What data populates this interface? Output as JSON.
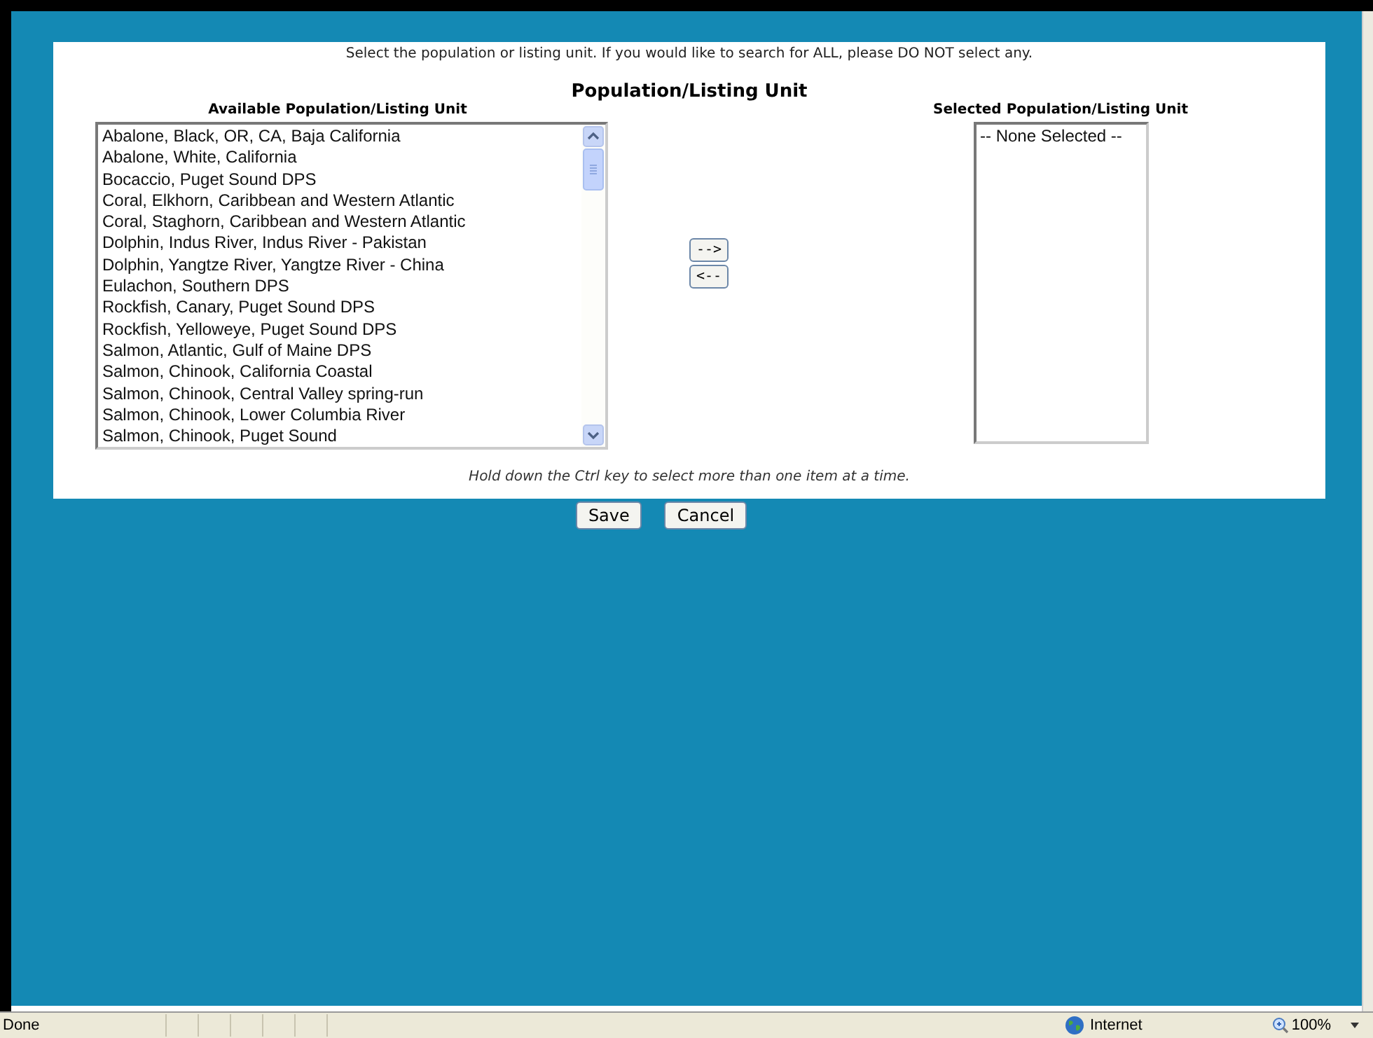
{
  "instruction": "Select the population or listing unit. If you would like to search for ALL, please DO NOT select any.",
  "title": "Population/Listing Unit",
  "available": {
    "heading": "Available Population/Listing Unit",
    "items": [
      {
        "label": "Abalone, Black, OR, CA, Baja California"
      },
      {
        "label": "Abalone, White, California"
      },
      {
        "label": "Bocaccio, Puget Sound DPS"
      },
      {
        "label": "Coral, Elkhorn, Caribbean and Western Atlantic"
      },
      {
        "label": "Coral, Staghorn, Caribbean and Western Atlantic"
      },
      {
        "label": "Dolphin, Indus River, Indus River - Pakistan"
      },
      {
        "label": "Dolphin, Yangtze River, Yangtze River - China"
      },
      {
        "label": "Eulachon, Southern DPS"
      },
      {
        "label": "Rockfish, Canary, Puget Sound DPS"
      },
      {
        "label": "Rockfish, Yelloweye, Puget Sound DPS"
      },
      {
        "label": "Salmon, Atlantic, Gulf of Maine DPS"
      },
      {
        "label": "Salmon, Chinook, California Coastal"
      },
      {
        "label": "Salmon, Chinook, Central Valley spring-run"
      },
      {
        "label": "Salmon, Chinook, Lower Columbia River"
      },
      {
        "label": "Salmon, Chinook, Puget Sound"
      }
    ]
  },
  "move_buttons": [
    "-->",
    "<--"
  ],
  "selected": {
    "heading": "Selected Population/Listing Unit",
    "items": [
      {
        "label": "-- None Selected --"
      }
    ]
  },
  "hint": "Hold down the Ctrl key to select more than one item at a time.",
  "buttons": [
    "Save",
    "Cancel"
  ],
  "status_bar": {
    "status": "Done",
    "zone": "Internet",
    "zoom": "100%"
  }
}
